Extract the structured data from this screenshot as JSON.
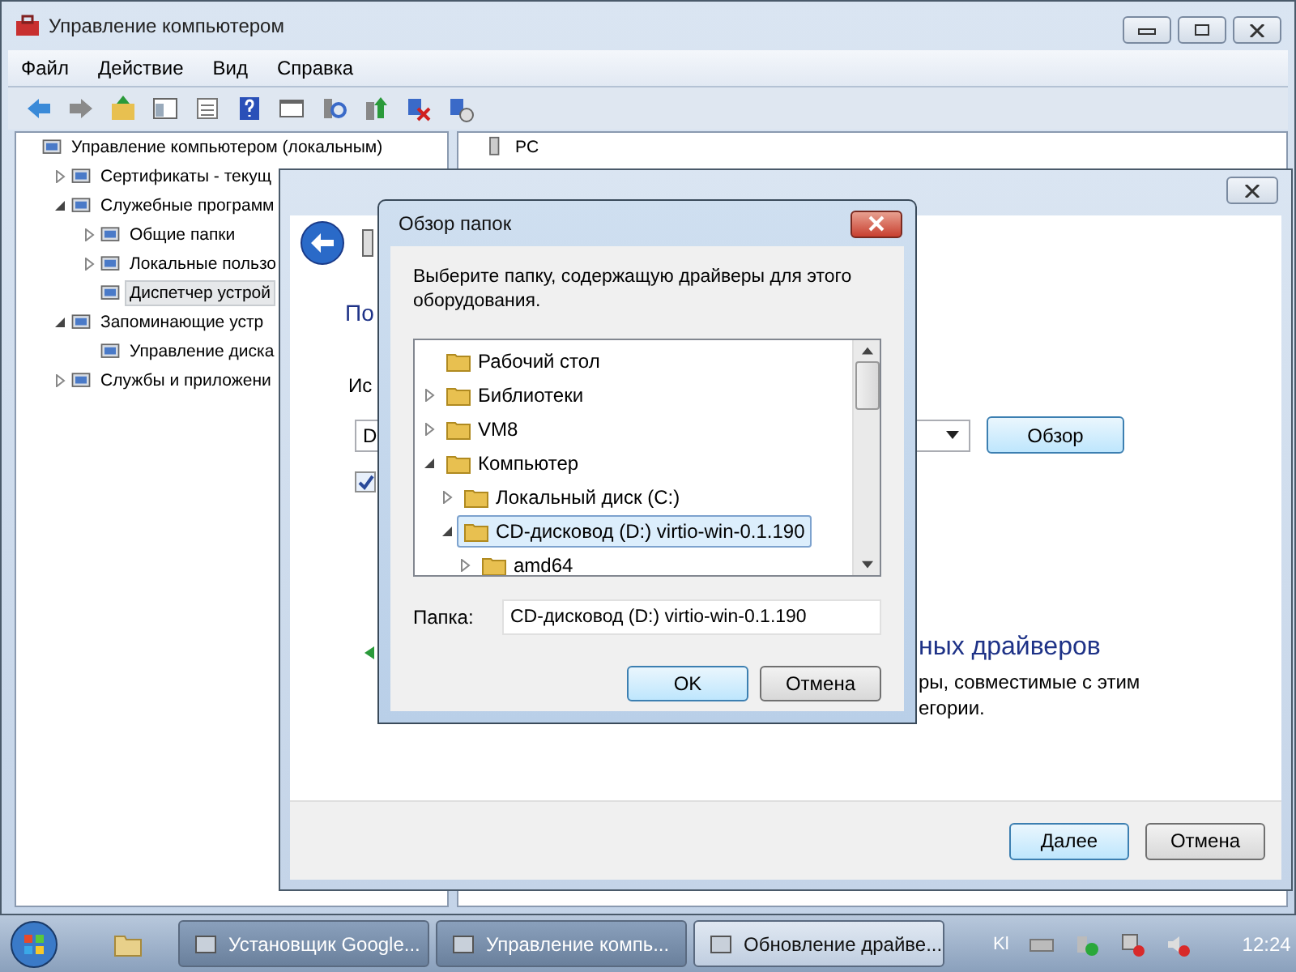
{
  "main_window": {
    "title": "Управление компьютером",
    "menu": [
      "Файл",
      "Действие",
      "Вид",
      "Справка"
    ],
    "tree": [
      {
        "label": "Управление компьютером (локальным)",
        "selected": false,
        "children": [
          {
            "label": "Сертификаты - текущ",
            "selected": false,
            "expanded": false
          },
          {
            "label": "Служебные программ",
            "selected": false,
            "expanded": true,
            "children": [
              {
                "label": "Общие папки",
                "selected": false,
                "expanded": false
              },
              {
                "label": "Локальные пользо",
                "selected": false,
                "expanded": false
              },
              {
                "label": "Диспетчер устрой",
                "selected": true
              }
            ]
          },
          {
            "label": "Запоминающие устр",
            "selected": false,
            "expanded": true,
            "children": [
              {
                "label": "Управление диска",
                "selected": false
              }
            ]
          },
          {
            "label": "Службы и приложени",
            "selected": false,
            "expanded": false
          }
        ]
      }
    ],
    "right_pane": {
      "item": "PC"
    }
  },
  "wizard": {
    "heading": "По",
    "source_label": "Ис",
    "path_value": "D",
    "browse_button": "Обзор",
    "include_subfolders": true,
    "option_title": "ных драйверов",
    "option_text": [
      "ры, совместимые с этим",
      "егории."
    ],
    "buttons": [
      {
        "label": "Далее",
        "default": true
      },
      {
        "label": "Отмена",
        "default": false
      }
    ]
  },
  "folder_dialog": {
    "title": "Обзор папок",
    "instruction": "Выберите папку, содержащую драйверы для этого оборудования.",
    "tree": [
      {
        "label": "Рабочий стол",
        "selected": false
      },
      {
        "label": "Библиотеки",
        "selected": false,
        "expanded": false
      },
      {
        "label": "VM8",
        "selected": false,
        "expanded": false
      },
      {
        "label": "Компьютер",
        "selected": false,
        "expanded": true,
        "children": [
          {
            "label": "Локальный диск (C:)",
            "selected": false,
            "expanded": false
          },
          {
            "label": "CD-дисковод (D:) virtio-win-0.1.190",
            "selected": true,
            "expanded": true,
            "children": [
              {
                "label": "amd64",
                "selected": false,
                "expanded": false
              }
            ]
          }
        ]
      }
    ],
    "folder_label": "Папка:",
    "folder_value": "CD-дисковод (D:) virtio-win-0.1.190",
    "buttons": [
      {
        "label": "OK",
        "default": true
      },
      {
        "label": "Отмена",
        "default": false
      }
    ]
  },
  "taskbar": {
    "buttons": [
      {
        "label": "Установщик Google...",
        "selected": false
      },
      {
        "label": "Управление компь...",
        "selected": false
      },
      {
        "label": "Обновление драйве...",
        "selected": true
      }
    ],
    "language": "Kl",
    "time": "12:24"
  }
}
